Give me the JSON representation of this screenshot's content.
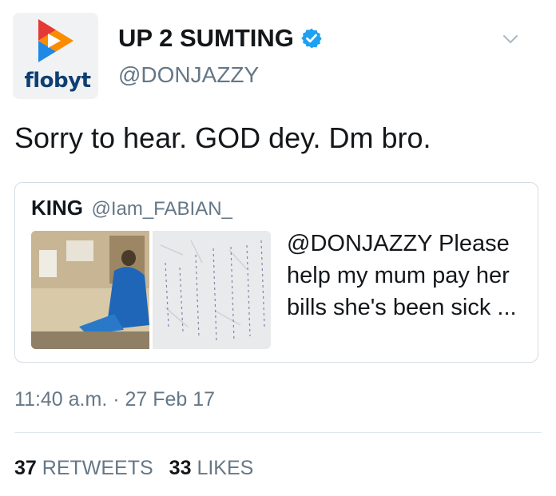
{
  "author": {
    "avatar_brand": "flobyt",
    "name": "UP 2 SUMTING",
    "handle": "@DONJAZZY",
    "verified": true
  },
  "tweet": {
    "text": "Sorry to hear. GOD dey. Dm bro.",
    "timestamp": "11:40 a.m. · 27 Feb 17"
  },
  "quoted": {
    "name": "KING",
    "handle": "@Iam_FABIAN_",
    "text": "@DONJAZZY Please help my mum pay her bills she's been sick ..."
  },
  "stats": {
    "retweets_count": "37",
    "retweets_label": "RETWEETS",
    "likes_count": "33",
    "likes_label": "LIKES"
  },
  "colors": {
    "verified_blue": "#1da1f2",
    "secondary_text": "#657786",
    "brand_navy": "#0d3f72"
  },
  "icons": {
    "menu": "chevron-down-icon",
    "verified": "verified-badge-icon"
  }
}
